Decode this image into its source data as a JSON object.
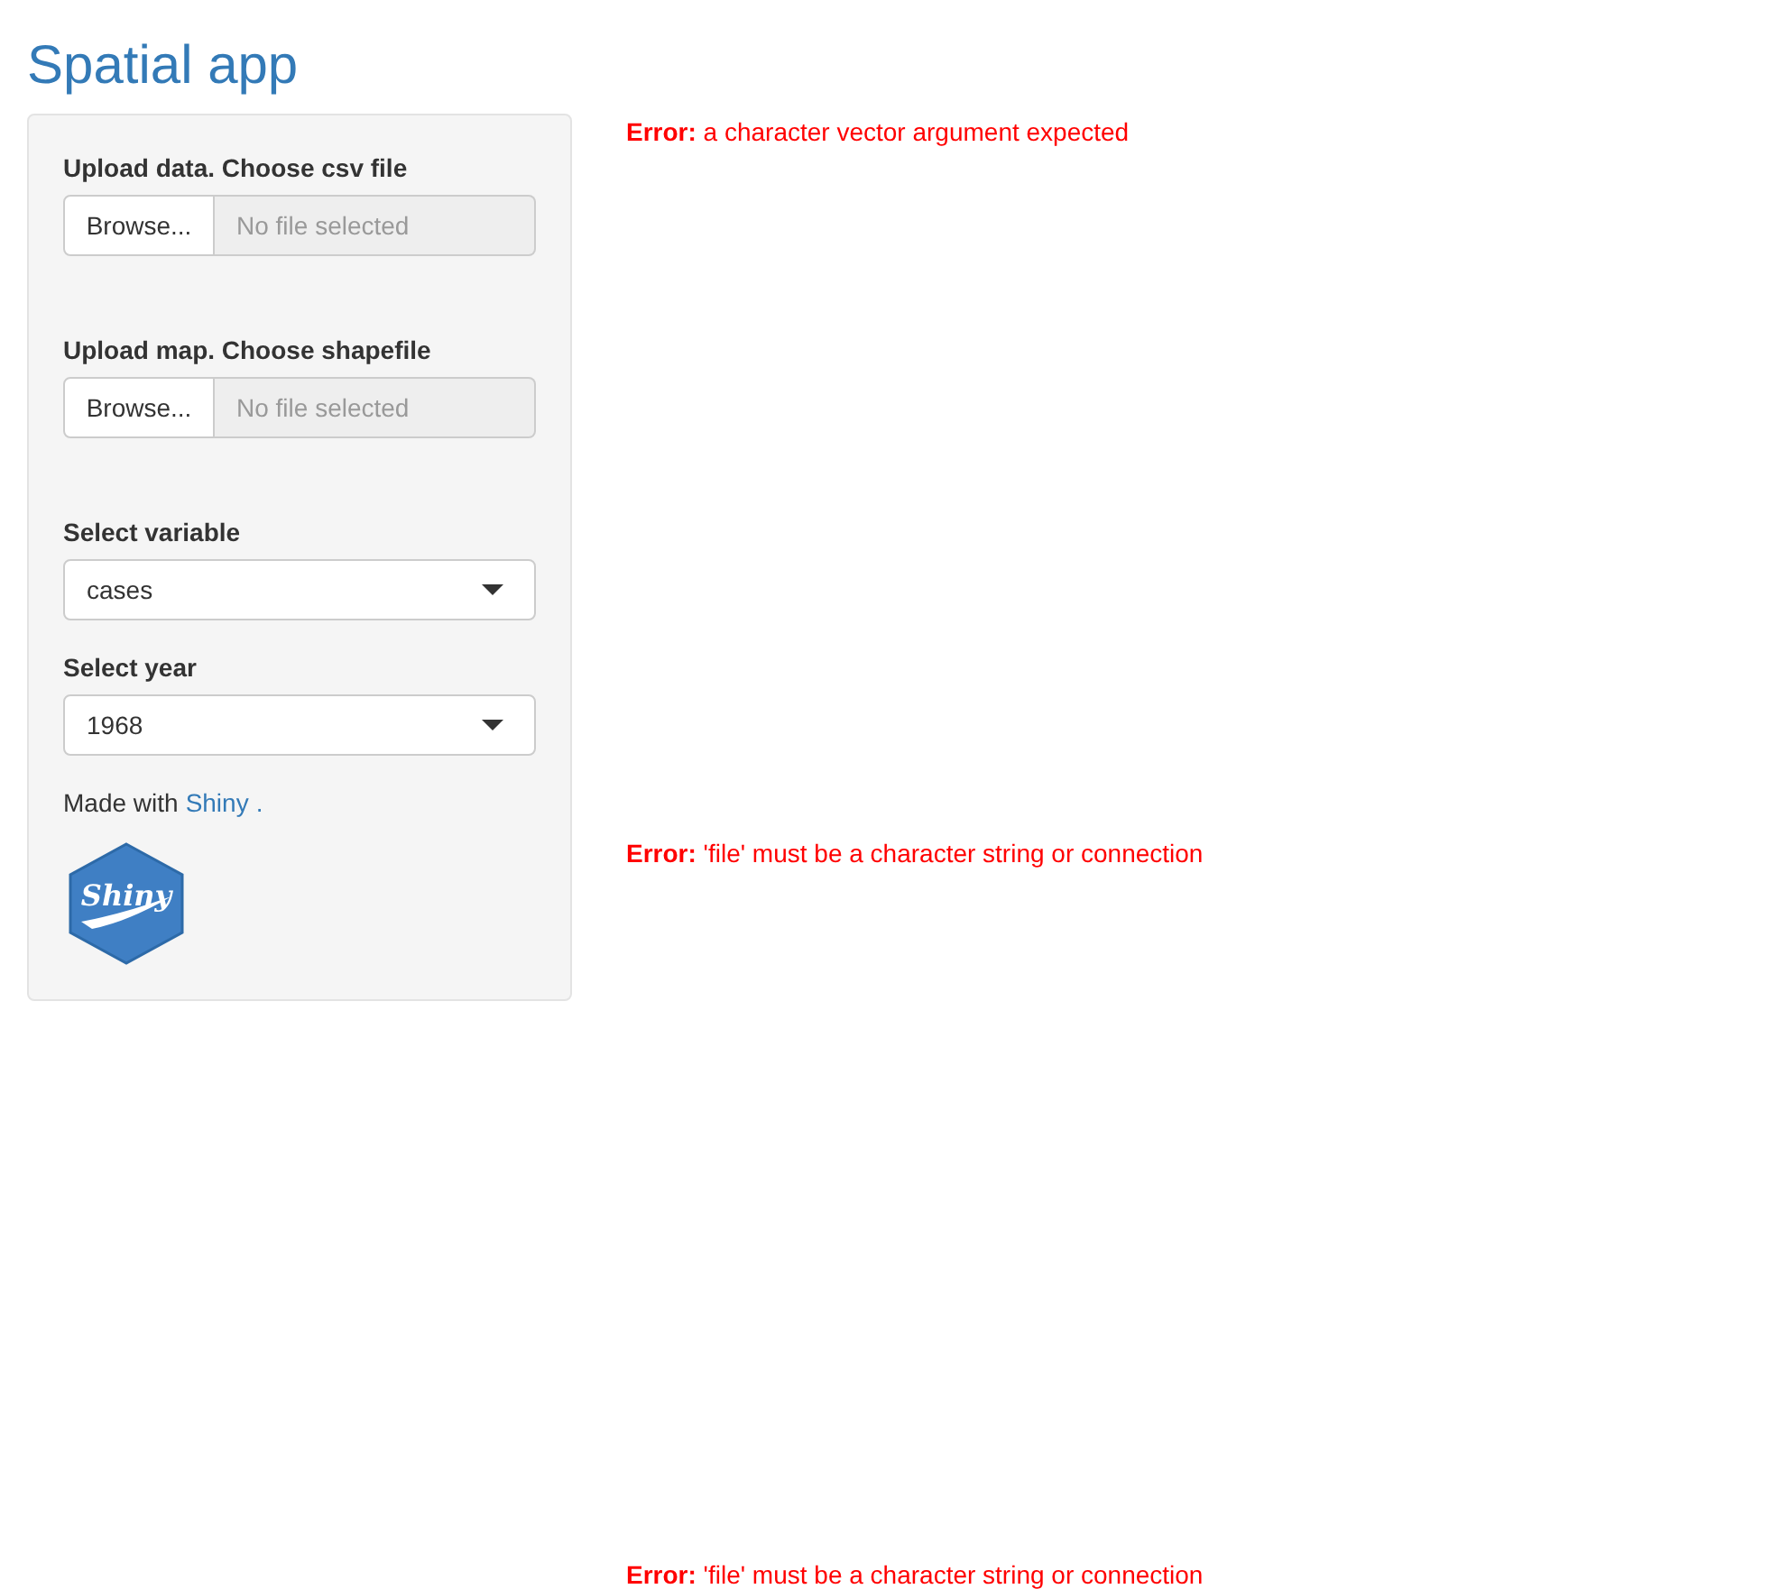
{
  "title": "Spatial app",
  "sidebar": {
    "inputs": [
      {
        "kind": "file",
        "label": "Upload data. Choose csv file",
        "button": "Browse...",
        "placeholder": "No file selected"
      },
      {
        "kind": "file",
        "label": "Upload map. Choose shapefile",
        "button": "Browse...",
        "placeholder": "No file selected"
      },
      {
        "kind": "select",
        "label": "Select variable",
        "value": "cases"
      },
      {
        "kind": "select",
        "label": "Select year",
        "value": "1968"
      }
    ],
    "credit": {
      "text": "Made with",
      "link": "Shiny",
      "after": "."
    },
    "logo": {
      "text": "Shiny"
    }
  },
  "outputs": [
    {
      "message": "**Error:** a character vector argument expected"
    },
    {
      "message": "**Error:** 'file' must be a character string or connection"
    },
    {
      "message": "**Error:** 'file' must be a character string or connection"
    }
  ]
}
